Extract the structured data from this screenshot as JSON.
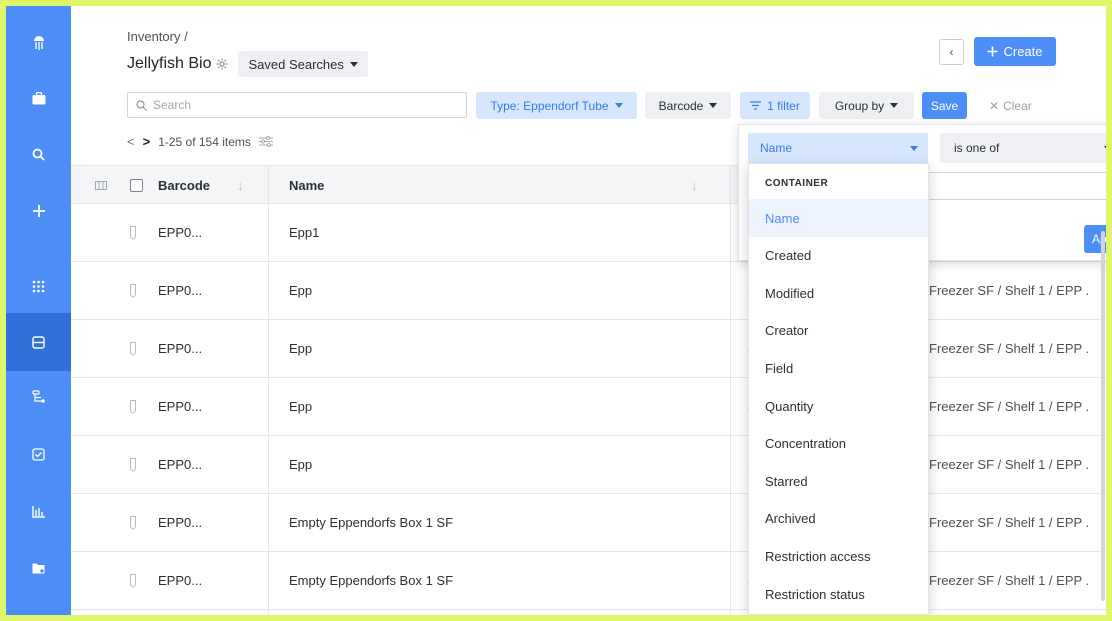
{
  "sidebar": {
    "icons": [
      "jellyfish-logo-icon",
      "briefcase-icon",
      "search-icon",
      "plus-icon",
      "apps-grid-icon",
      "inventory-icon",
      "workflow-icon",
      "tasks-icon",
      "analytics-icon",
      "folder-settings-icon"
    ]
  },
  "header": {
    "breadcrumb": "Inventory /",
    "title": "Jellyfish Bio",
    "saved_searches": "Saved Searches",
    "create": "Create",
    "back": "‹"
  },
  "toolbar": {
    "search_placeholder": "Search",
    "type_filter": "Type: Eppendorf Tube",
    "barcode": "Barcode",
    "filter_count": "1 filter",
    "group_by": "Group by",
    "save": "Save",
    "clear": "Clear"
  },
  "pager": {
    "range": "1-25 of 154 items"
  },
  "table": {
    "columns": {
      "barcode": "Barcode",
      "name": "Name"
    },
    "rows": [
      {
        "barcode": "EPP0...",
        "name": "Epp1",
        "status": "",
        "location": ""
      },
      {
        "barcode": "EPP0...",
        "name": "Epp",
        "status": "S",
        "location": "Freezer SF / Shelf 1 / EPP ."
      },
      {
        "barcode": "EPP0...",
        "name": "Epp",
        "status": "S",
        "location": "Freezer SF / Shelf 1 / EPP ."
      },
      {
        "barcode": "EPP0...",
        "name": "Epp",
        "status": "S",
        "location": "Freezer SF / Shelf 1 / EPP ."
      },
      {
        "barcode": "EPP0...",
        "name": "Epp",
        "status": "S",
        "location": "Freezer SF / Shelf 1 / EPP ."
      },
      {
        "barcode": "EPP0...",
        "name": "Empty Eppendorfs Box 1 SF",
        "status": "S",
        "location": "Freezer SF / Shelf 1 / EPP ."
      },
      {
        "barcode": "EPP0...",
        "name": "Empty Eppendorfs Box 1 SF",
        "status": "S",
        "location": "Freezer SF / Shelf 1 / EPP ."
      }
    ]
  },
  "filter": {
    "field": "Name",
    "operator": "is one of",
    "apply": "Ap",
    "dropdown": {
      "section": "CONTAINER",
      "items": [
        "Name",
        "Created",
        "Modified",
        "Creator",
        "Field",
        "Quantity",
        "Concentration",
        "Starred",
        "Archived",
        "Restriction access",
        "Restriction status"
      ]
    }
  },
  "colors": {
    "accent": "#4d8ff7",
    "sidebar": "#4d8ff7",
    "frame": "#dff56a"
  }
}
